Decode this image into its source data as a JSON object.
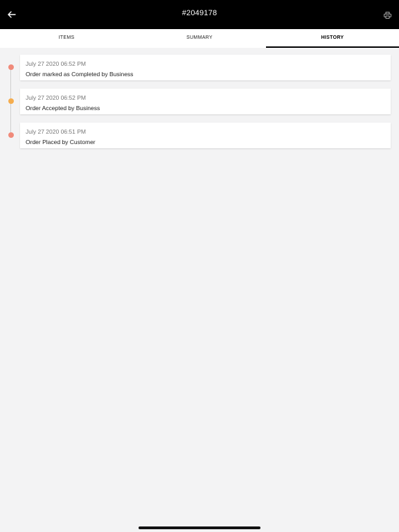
{
  "header": {
    "title": "#2049178",
    "back_icon": "arrow-left-icon",
    "print_icon": "printer-icon"
  },
  "tabs": [
    {
      "label": "ITEMS",
      "active": false
    },
    {
      "label": "SUMMARY",
      "active": false
    },
    {
      "label": "HISTORY",
      "active": true
    }
  ],
  "history": [
    {
      "time": "July 27 2020 06:52 PM",
      "message": "Order marked as Completed by Business",
      "dot_color": "#f08a7a"
    },
    {
      "time": "July 27 2020 06:52 PM",
      "message": "Order Accepted by Business",
      "dot_color": "#f5ad4e"
    },
    {
      "time": "July 27 2020 06:51 PM",
      "message": "Order Placed by Customer",
      "dot_color": "#f08a7a"
    }
  ],
  "colors": {
    "header_bg": "#000000",
    "page_bg": "#f3f3f4"
  }
}
